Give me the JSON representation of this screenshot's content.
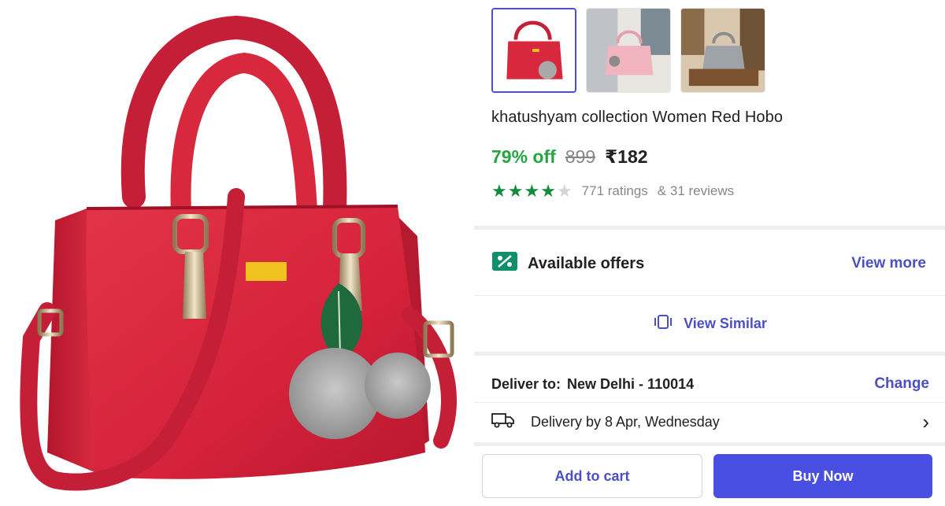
{
  "product": {
    "title": "khatushyam collection Women Red Hobo",
    "discount": "79% off",
    "mrp": "899",
    "price": "₹182",
    "rating_stars": 4,
    "rating_max": 5,
    "ratings_text": "771 ratings",
    "reviews_text": "& 31 reviews"
  },
  "thumbnails": [
    {
      "name": "red-bag-front",
      "selected": true
    },
    {
      "name": "pink-bag-lifestyle",
      "selected": false
    },
    {
      "name": "grey-bag-room",
      "selected": false
    }
  ],
  "offers": {
    "label": "Available offers",
    "action": "View more",
    "icon": "offer-tag-icon"
  },
  "similar": {
    "label": "View Similar",
    "icon": "view-similar-icon"
  },
  "delivery": {
    "deliver_to_label": "Deliver to:",
    "location": "New Delhi - 110014",
    "change_label": "Change",
    "eta": "Delivery by 8 Apr, Wednesday",
    "icon": "truck-icon"
  },
  "actions": {
    "add_to_cart": "Add to cart",
    "buy_now": "Buy Now"
  },
  "colors": {
    "accent": "#4a4fc4",
    "buy_button": "#4a4fe4",
    "discount": "#26a541",
    "star": "#148a3c",
    "bag": "#d8283e"
  }
}
